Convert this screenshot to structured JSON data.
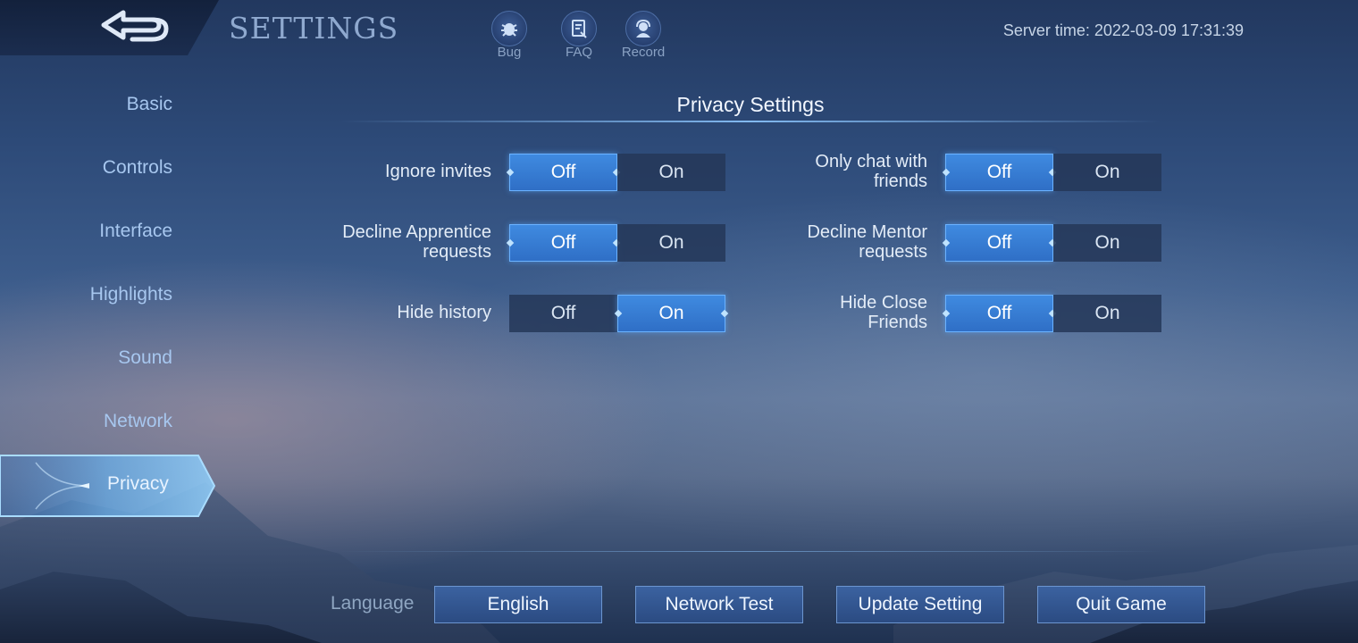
{
  "header": {
    "title": "SETTINGS",
    "server_time": "Server time: 2022-03-09 17:31:39",
    "tools": [
      {
        "label": "Bug",
        "icon": "bug-icon"
      },
      {
        "label": "FAQ",
        "icon": "faq-icon"
      },
      {
        "label": "Record",
        "icon": "record-icon"
      }
    ]
  },
  "sidebar": {
    "items": [
      {
        "label": "Basic"
      },
      {
        "label": "Controls"
      },
      {
        "label": "Interface"
      },
      {
        "label": "Highlights"
      },
      {
        "label": "Sound"
      },
      {
        "label": "Network"
      },
      {
        "label": "Privacy",
        "active": true
      }
    ]
  },
  "section": {
    "title": "Privacy Settings"
  },
  "settings": [
    {
      "label": "Ignore invites",
      "value": "Off",
      "off": "Off",
      "on": "On"
    },
    {
      "label": "Only chat with friends",
      "value": "Off",
      "off": "Off",
      "on": "On"
    },
    {
      "label": "Decline Apprentice requests",
      "value": "Off",
      "off": "Off",
      "on": "On"
    },
    {
      "label": "Decline Mentor requests",
      "value": "Off",
      "off": "Off",
      "on": "On"
    },
    {
      "label": "Hide history",
      "value": "On",
      "off": "Off",
      "on": "On"
    },
    {
      "label": "Hide Close Friends",
      "value": "Off",
      "off": "Off",
      "on": "On"
    }
  ],
  "bottom": {
    "language_label": "Language",
    "language_value": "English",
    "network_test": "Network Test",
    "update_setting": "Update Setting",
    "quit_game": "Quit Game"
  },
  "colors": {
    "accent": "#3f8ae0",
    "accent_border": "#6bb2ff",
    "nav_text": "#a7c7ef"
  }
}
